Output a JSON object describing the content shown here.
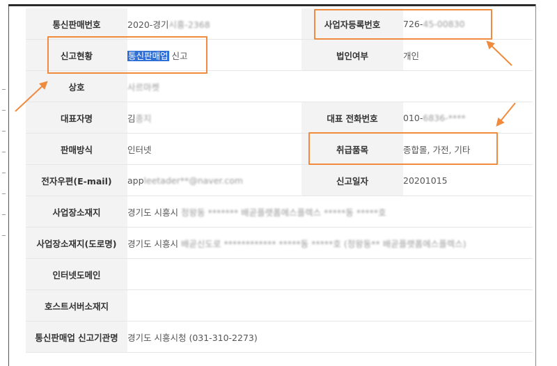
{
  "rows": [
    {
      "label": "통신판매번호",
      "value_prefix": "2020-경기",
      "value_masked": "시흥-2368",
      "label2": "사업자등록번호",
      "value2_prefix": "726-",
      "value2_masked": "45-00830"
    },
    {
      "label": "신고현황",
      "value_highlight": "통신판매업",
      "value_suffix": " 신고",
      "label2": "법인여부",
      "value2": "개인"
    },
    {
      "label": "상호",
      "value_masked": "사르마켓"
    },
    {
      "label": "대표자명",
      "value_prefix": "김",
      "value_masked": "종지",
      "label2": "대표 전화번호",
      "value2_prefix": "010-",
      "value2_masked": "6836-****"
    },
    {
      "label": "판매방식",
      "value": "인터넷",
      "label2": "취급품목",
      "value2": "종합몰, 가전, 기타"
    },
    {
      "label": "전자우편(E-mail)",
      "value_prefix": "app",
      "value_masked": "leetader**@naver.com",
      "label2": "신고일자",
      "value2": "20201015"
    },
    {
      "label": "사업장소재지",
      "value_prefix": "경기도 시흥시",
      "value_masked": "정왕동 ******* 배곧플랫폼에스플렉스 *****동 *****호"
    },
    {
      "label": "사업장소재지(도로명)",
      "value_prefix": "경기도 시흥시",
      "value_masked": "배곧신도로 ************ *****동 *****호 (정왕동** 배곧플랫폼에스플렉스)"
    },
    {
      "label": "인터넷도메인",
      "value": ""
    },
    {
      "label": "호스트서버소재지",
      "value": ""
    },
    {
      "label": "통신판매업 신고기관명",
      "value": "경기도 시흥시청  (031-310-2273)"
    }
  ],
  "accent_color": "#f08a3c",
  "highlight_color": "#2f6fd6"
}
